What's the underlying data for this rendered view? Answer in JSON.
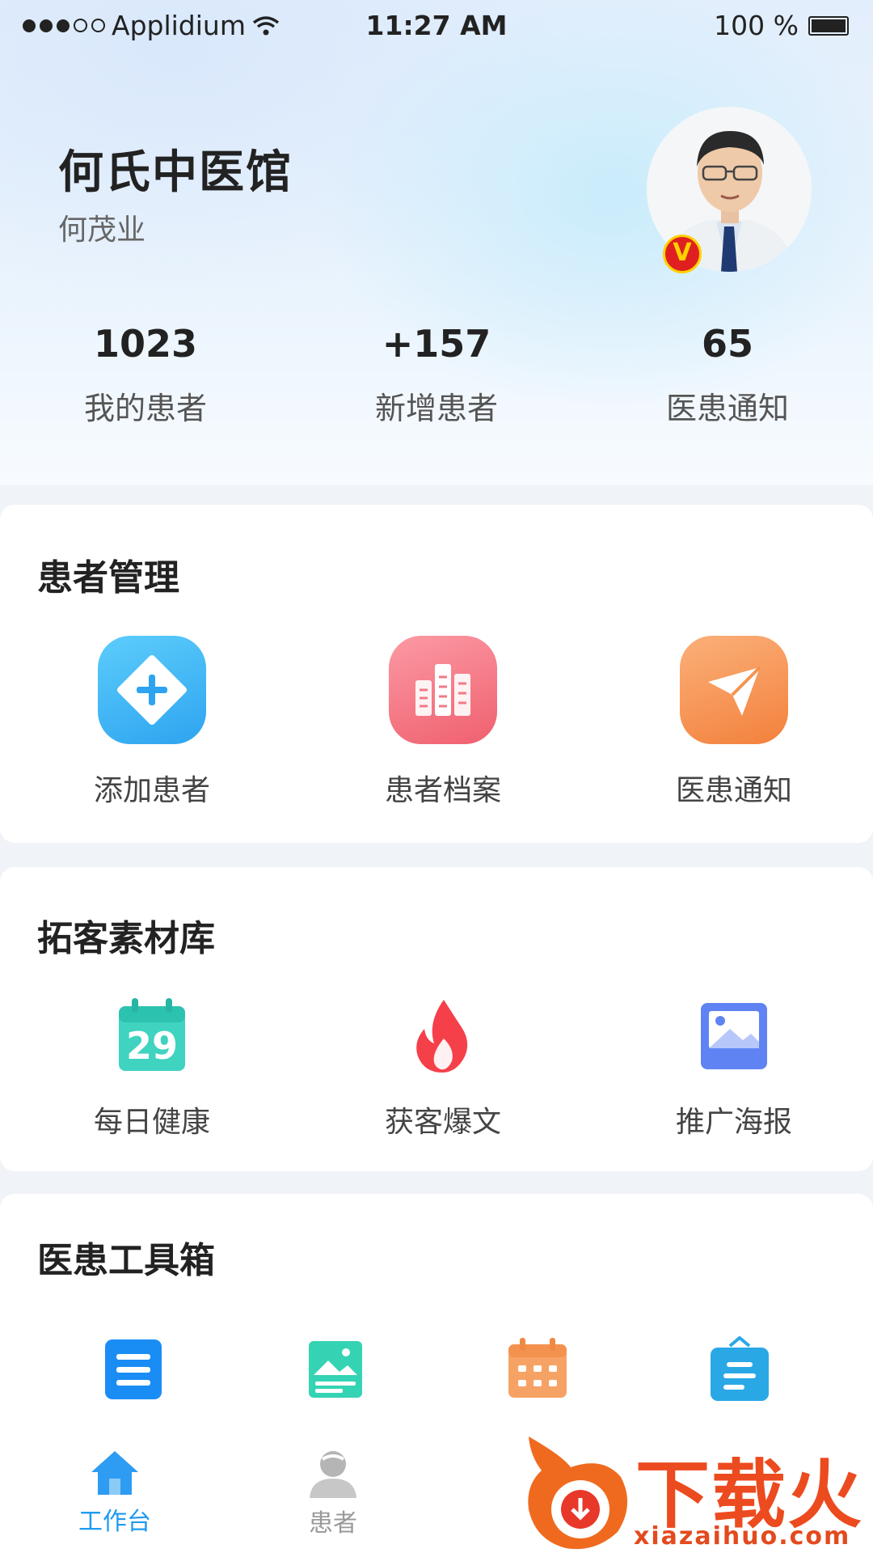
{
  "status_bar": {
    "carrier": "Applidium",
    "time": "11:27 AM",
    "battery": "100 %"
  },
  "header": {
    "clinic_name": "何氏中医馆",
    "doctor_name": "何茂业",
    "verified_badge": "V",
    "stats": [
      {
        "value": "1023",
        "label": "我的患者"
      },
      {
        "value": "+157",
        "label": "新增患者"
      },
      {
        "value": "65",
        "label": "医患通知"
      }
    ]
  },
  "patient_management": {
    "title": "患者管理",
    "items": [
      {
        "label": "添加患者",
        "icon": "add-patient-icon",
        "color": "#3fb6f5"
      },
      {
        "label": "患者档案",
        "icon": "patient-records-icon",
        "color": "#f7707f"
      },
      {
        "label": "医患通知",
        "icon": "send-notice-icon",
        "color": "#f58c4a"
      }
    ]
  },
  "material_library": {
    "title": "拓客素材库",
    "items": [
      {
        "label": "每日健康",
        "icon": "calendar-29-icon",
        "calendar_day": "29"
      },
      {
        "label": "获客爆文",
        "icon": "flame-icon"
      },
      {
        "label": "推广海报",
        "icon": "poster-image-icon"
      }
    ]
  },
  "toolbox": {
    "title": "医患工具箱",
    "icons": [
      "document-list-icon",
      "picture-card-icon",
      "calendar-grid-icon",
      "clipboard-icon"
    ]
  },
  "tabbar": {
    "tabs": [
      {
        "label": "工作台",
        "icon": "home-icon",
        "active": true
      },
      {
        "label": "患者",
        "icon": "patient-icon",
        "active": false
      }
    ],
    "active_color": "#1e9bf0",
    "inactive_color": "#9a9a9a"
  },
  "watermark": {
    "text": "下载火",
    "url": "xiazaihuo.com"
  }
}
